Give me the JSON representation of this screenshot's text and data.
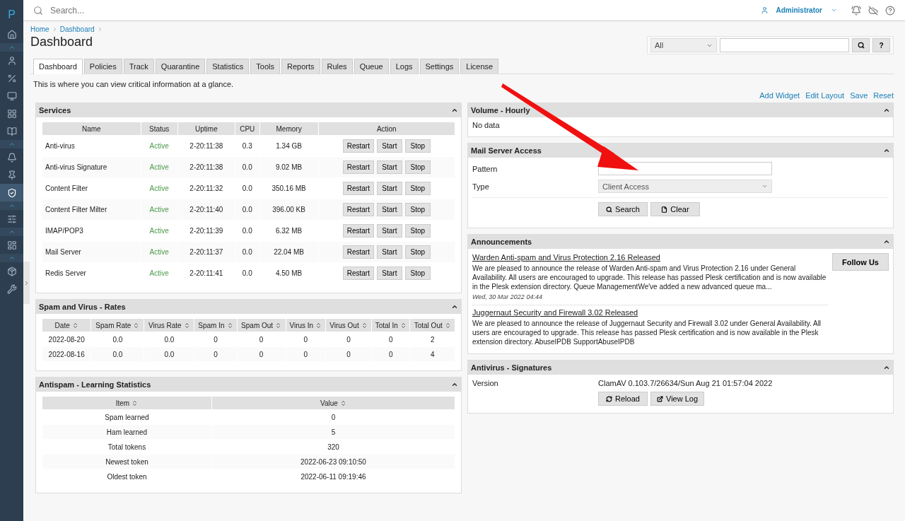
{
  "topbar": {
    "search_placeholder": "Search...",
    "user": "Administrator"
  },
  "sidebar": {
    "logo": "P",
    "groups": [
      {
        "items": [
          {
            "selected": false
          }
        ]
      },
      {
        "expanded": true,
        "items": [
          {
            "selected": false
          },
          {
            "selected": false
          },
          {
            "selected": false
          },
          {
            "selected": false
          },
          {
            "selected": false
          }
        ]
      },
      {
        "expanded": true,
        "items": [
          {
            "selected": false
          },
          {
            "selected": false
          },
          {
            "selected": true
          }
        ]
      },
      {
        "expanded": true,
        "items": [
          {
            "selected": false
          }
        ]
      },
      {
        "expanded": true,
        "items": [
          {
            "selected": false
          }
        ]
      },
      {
        "expanded": true,
        "items": [
          {
            "selected": false
          },
          {
            "selected": false
          }
        ]
      }
    ]
  },
  "breadcrumb": [
    "Home",
    "Dashboard"
  ],
  "title": "Dashboard",
  "filter": {
    "scope": "All",
    "help": "?"
  },
  "tabs": [
    {
      "label": "Dashboard",
      "selected": true
    },
    {
      "label": "Policies",
      "selected": false
    },
    {
      "label": "Track",
      "selected": false
    },
    {
      "label": "Quarantine",
      "selected": false
    },
    {
      "label": "Statistics",
      "selected": false
    },
    {
      "label": "Tools",
      "selected": false
    },
    {
      "label": "Reports",
      "selected": false
    },
    {
      "label": "Rules",
      "selected": false
    },
    {
      "label": "Queue",
      "selected": false
    },
    {
      "label": "Logs",
      "selected": false
    },
    {
      "label": "Settings",
      "selected": false
    },
    {
      "label": "License",
      "selected": false
    }
  ],
  "intro": "This is where you can view critical information at a glance.",
  "actions": [
    "Add Widget",
    "Edit Layout",
    "Save",
    "Reset"
  ],
  "services": {
    "title": "Services",
    "columns": [
      "Name",
      "Status",
      "Uptime",
      "CPU",
      "Memory",
      "Action"
    ],
    "rows": [
      {
        "name": "Anti-virus",
        "status": "Active",
        "uptime": "2-20:11:38",
        "cpu": "0.3",
        "memory": "1.34 GB",
        "actions": [
          "Restart",
          "Start",
          "Stop"
        ]
      },
      {
        "name": "Anti-virus Signature",
        "status": "Active",
        "uptime": "2-20:11:38",
        "cpu": "0.0",
        "memory": "9.02 MB",
        "actions": [
          "Restart",
          "Start",
          "Stop"
        ]
      },
      {
        "name": "Content Filter",
        "status": "Active",
        "uptime": "2-20:11:32",
        "cpu": "0.0",
        "memory": "350.16 MB",
        "actions": [
          "Restart",
          "Start",
          "Stop"
        ]
      },
      {
        "name": "Content Filter Milter",
        "status": "Active",
        "uptime": "2-20:11:40",
        "cpu": "0.0",
        "memory": "396.00 KB",
        "actions": [
          "Restart",
          "Start",
          "Stop"
        ]
      },
      {
        "name": "IMAP/POP3",
        "status": "Active",
        "uptime": "2-20:11:39",
        "cpu": "0.0",
        "memory": "6.32 MB",
        "actions": [
          "Restart",
          "Start",
          "Stop"
        ]
      },
      {
        "name": "Mail Server",
        "status": "Active",
        "uptime": "2-20:11:37",
        "cpu": "0.0",
        "memory": "22.04 MB",
        "actions": [
          "Restart",
          "Start",
          "Stop"
        ]
      },
      {
        "name": "Redis Server",
        "status": "Active",
        "uptime": "2-20:11:41",
        "cpu": "0.0",
        "memory": "4.50 MB",
        "actions": [
          "Restart",
          "Start",
          "Stop"
        ]
      }
    ]
  },
  "rates": {
    "title": "Spam and Virus - Rates",
    "columns": [
      "Date",
      "Spam Rate",
      "Virus Rate",
      "Spam In",
      "Spam Out",
      "Virus In",
      "Virus Out",
      "Total In",
      "Total Out"
    ],
    "rows": [
      [
        "2022-08-20",
        "0.0",
        "0.0",
        "0",
        "0",
        "0",
        "0",
        "0",
        "2"
      ],
      [
        "2022-08-16",
        "0.0",
        "0.0",
        "0",
        "0",
        "0",
        "0",
        "0",
        "4"
      ]
    ]
  },
  "learning": {
    "title": "Antispam - Learning Statistics",
    "columns": [
      "Item",
      "Value"
    ],
    "rows": [
      [
        "Spam learned",
        "0"
      ],
      [
        "Ham learned",
        "5"
      ],
      [
        "Total tokens",
        "320"
      ],
      [
        "Newest token",
        "2022-06-23 09:10:50"
      ],
      [
        "Oldest token",
        "2022-06-11 09:19:46"
      ]
    ]
  },
  "volume": {
    "title": "Volume - Hourly",
    "message": "No data"
  },
  "mail_access": {
    "title": "Mail Server Access",
    "pattern_label": "Pattern",
    "type_label": "Type",
    "type_value": "Client Access",
    "buttons": [
      "Search",
      "Clear"
    ]
  },
  "announcements": {
    "title": "Announcements",
    "follow": "Follow Us",
    "items": [
      {
        "title": "Warden Anti-spam and Virus Protection 2.16 Released",
        "body": "We are pleased to announce the release of Warden Anti-spam and Virus Protection 2.16 under General Availability. All users are encouraged to upgrade. This release has passed Plesk certification and is now available in the Plesk extension directory. Queue ManagementWe've added a new advanced queue ma...",
        "date": "Wed, 30 Mar 2022 04:44"
      },
      {
        "title": "Juggernaut Security and Firewall 3.02 Released",
        "body": "We are pleased to announce the release of Juggernaut Security and Firewall 3.02 under General Availability. All users are encouraged to upgrade. This release has passed Plesk certification and is now available in the Plesk extension directory. AbuseIPDB SupportAbuseIPDB"
      }
    ]
  },
  "signatures": {
    "title": "Antivirus - Signatures",
    "version_label": "Version",
    "version": "ClamAV 0.103.7/26634/Sun Aug 21 01:57:04 2022",
    "buttons": [
      "Reload",
      "View Log"
    ]
  }
}
